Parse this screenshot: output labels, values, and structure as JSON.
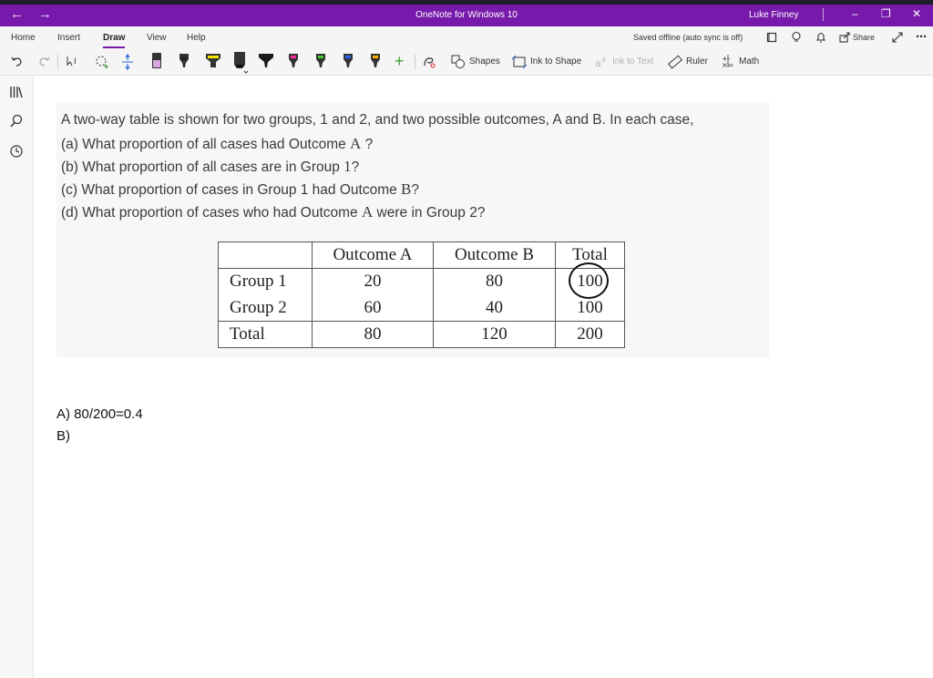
{
  "window": {
    "title": "OneNote for Windows 10",
    "user": "Luke Finney"
  },
  "menu": {
    "items": [
      "Home",
      "Insert",
      "Draw",
      "View",
      "Help"
    ],
    "active": "Draw",
    "sync_status": "Saved offline (auto sync is off)",
    "share_label": "Share"
  },
  "toolbar": {
    "shapes_label": "Shapes",
    "ink_to_shape_label": "Ink to Shape",
    "ink_to_text_label": "Ink to Text",
    "ruler_label": "Ruler",
    "math_label": "Math",
    "pens": [
      {
        "color": "#d9a7de",
        "type": "highlighter"
      },
      {
        "color": "#222222",
        "type": "pen"
      },
      {
        "color": "#f5e400",
        "type": "highlighter"
      },
      {
        "color": "#1a1a1a",
        "type": "highlighter"
      },
      {
        "color": "#1a1a1a",
        "type": "pen"
      },
      {
        "color": "#ff2a9d",
        "type": "pen"
      },
      {
        "color": "#3ccf2b",
        "type": "pen"
      },
      {
        "color": "#2463ff",
        "type": "pen"
      },
      {
        "color": "#ffb000",
        "type": "pen"
      }
    ]
  },
  "problem": {
    "intro": "A two-way table is shown for two groups, 1 and 2, and two possible outcomes, A and B. In each case,",
    "questions": [
      {
        "text": "(a) What proportion of all cases had Outcome ",
        "math": "A",
        "tail": " ?"
      },
      {
        "text": "(b) What proportion of all cases are in Group ",
        "math": "1",
        "tail": "?"
      },
      {
        "text": "(c) What proportion of cases in Group 1 had Outcome ",
        "math": "B",
        "tail": "?"
      },
      {
        "text": "(d) What proportion of cases who had Outcome ",
        "math": "A",
        "tail": " were in Group 2?"
      }
    ],
    "table": {
      "headers": [
        "",
        "Outcome A",
        "Outcome B",
        "Total"
      ],
      "rows": [
        [
          "Group 1",
          "20",
          "80",
          "100"
        ],
        [
          "Group 2",
          "60",
          "40",
          "100"
        ],
        [
          "Total",
          "80",
          "120",
          "200"
        ]
      ]
    }
  },
  "answers": [
    "A) 80/200=0.4",
    "B)"
  ],
  "colors": {
    "accent": "#7719aa",
    "ink": "#111111"
  }
}
